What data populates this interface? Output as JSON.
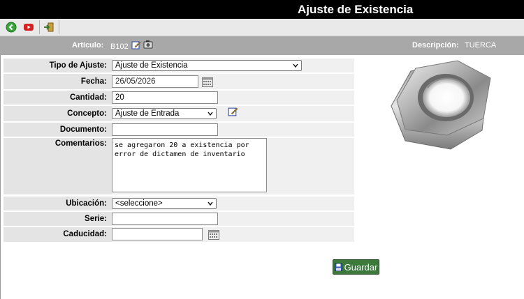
{
  "header": {
    "title": "Ajuste de Existencia"
  },
  "toolbar": {
    "icons": [
      "back-icon",
      "youtube-icon",
      "exit-icon"
    ]
  },
  "articulo": {
    "label": "Artículo:",
    "code": "B102",
    "descripcion_label": "Descripción:",
    "descripcion_value": "TUERCA"
  },
  "form": {
    "tipo_ajuste": {
      "label": "Tipo de Ajuste:",
      "value": "Ajuste de Existencia"
    },
    "fecha": {
      "label": "Fecha:",
      "value": "26/05/2026"
    },
    "cantidad": {
      "label": "Cantidad:",
      "value": "20"
    },
    "concepto": {
      "label": "Concepto:",
      "value": "Ajuste de Entrada"
    },
    "documento": {
      "label": "Documento:",
      "value": ""
    },
    "comentarios": {
      "label": "Comentarios:",
      "value": "se agregaron 20 a existencia por error de dictamen de inventario"
    },
    "ubicacion": {
      "label": "Ubicación:",
      "value": "<seleccione>"
    },
    "serie": {
      "label": "Serie:",
      "value": ""
    },
    "caducidad": {
      "label": "Caducidad:",
      "value": ""
    }
  },
  "actions": {
    "save_label": "Guardar"
  },
  "colors": {
    "header_bg": "#000000",
    "toolbar_bg": "#e9e9e9",
    "infobar_bg": "#a8a8a8",
    "save_button_bg": "#3b7a3b"
  }
}
